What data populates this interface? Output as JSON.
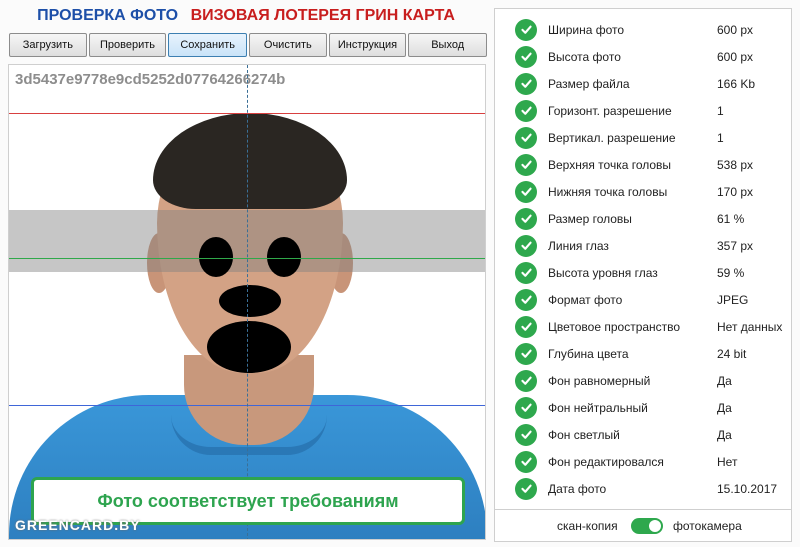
{
  "title": {
    "part1": "ПРОВЕРКА ФОТО",
    "part2": "ВИЗОВАЯ ЛОТЕРЕЯ ГРИН КАРТА"
  },
  "toolbar": {
    "load": "Загрузить",
    "check": "Проверить",
    "save": "Сохранить",
    "clear": "Очистить",
    "instructions": "Инструкция",
    "exit": "Выход"
  },
  "photo": {
    "hash": "3d5437e9778e9cd5252d07764266274b",
    "status": "Фото соответствует требованиям",
    "watermark": "GREENCARD.BY"
  },
  "checks": [
    {
      "label": "Ширина фото",
      "value": "600 px"
    },
    {
      "label": "Высота фото",
      "value": "600 px"
    },
    {
      "label": "Размер файла",
      "value": "166 Kb"
    },
    {
      "label": "Горизонт. разрешение",
      "value": "1"
    },
    {
      "label": "Вертикал. разрешение",
      "value": "1"
    },
    {
      "label": "Верхняя точка головы",
      "value": "538 px"
    },
    {
      "label": "Нижняя точка головы",
      "value": "170 px"
    },
    {
      "label": "Размер головы",
      "value": "61 %"
    },
    {
      "label": "Линия глаз",
      "value": "357 px"
    },
    {
      "label": "Высота уровня глаз",
      "value": "59 %"
    },
    {
      "label": "Формат фото",
      "value": "JPEG"
    },
    {
      "label": "Цветовое пространство",
      "value": "Нет данных"
    },
    {
      "label": "Глубина цвета",
      "value": "24 bit"
    },
    {
      "label": "Фон равномерный",
      "value": "Да"
    },
    {
      "label": "Фон нейтральный",
      "value": "Да"
    },
    {
      "label": "Фон светлый",
      "value": "Да"
    },
    {
      "label": "Фон редактировался",
      "value": "Нет"
    },
    {
      "label": "Дата фото",
      "value": "15.10.2017"
    }
  ],
  "toggle": {
    "left_label": "скан-копия",
    "right_label": "фотокамера",
    "state": "фотокамера"
  },
  "colors": {
    "ok_green": "#2ea84d",
    "title_blue": "#1d4fa8",
    "title_red": "#c81e1e"
  },
  "icons": {
    "check": "check-circle-icon"
  }
}
